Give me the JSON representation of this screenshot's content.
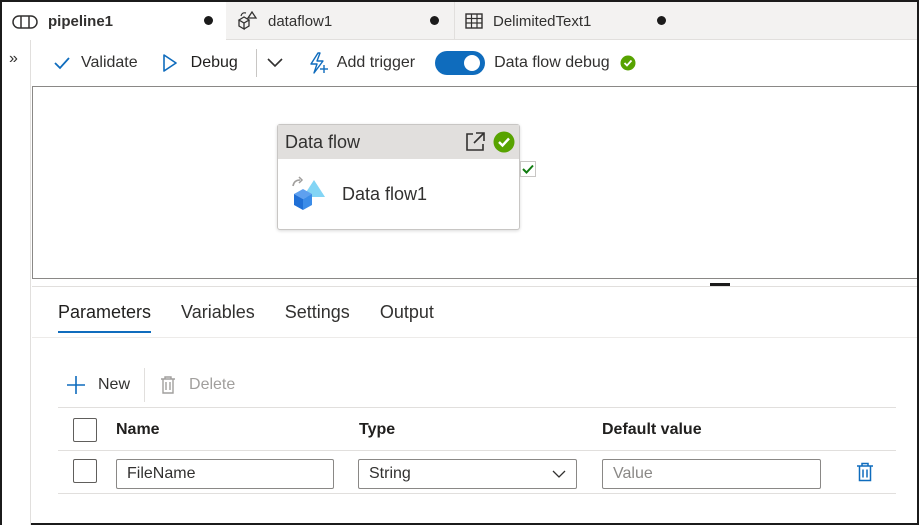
{
  "tabs": [
    {
      "label": "pipeline1",
      "icon": "pipeline-icon",
      "unsaved": true,
      "active": true
    },
    {
      "label": "dataflow1",
      "icon": "dataflow-icon",
      "unsaved": true,
      "active": false
    },
    {
      "label": "DelimitedText1",
      "icon": "table-icon",
      "unsaved": true,
      "active": false
    }
  ],
  "rail": {
    "expand_glyph": "»"
  },
  "toolbar": {
    "validate_label": "Validate",
    "debug_label": "Debug",
    "add_trigger_label": "Add trigger",
    "data_flow_debug_label": "Data flow debug",
    "data_flow_debug_on": true
  },
  "canvas": {
    "activity": {
      "type_label": "Data flow",
      "name": "Data flow1",
      "status": "succeeded"
    }
  },
  "panel": {
    "tabs": [
      "Parameters",
      "Variables",
      "Settings",
      "Output"
    ],
    "active_tab": "Parameters",
    "new_label": "New",
    "delete_label": "Delete",
    "columns": {
      "name": "Name",
      "type": "Type",
      "default": "Default value"
    },
    "rows": [
      {
        "name": "FileName",
        "type": "String",
        "default_placeholder": "Value"
      }
    ]
  },
  "colors": {
    "accent": "#0f6cbd",
    "success": "#57a300",
    "disabled": "#a19f9d"
  }
}
